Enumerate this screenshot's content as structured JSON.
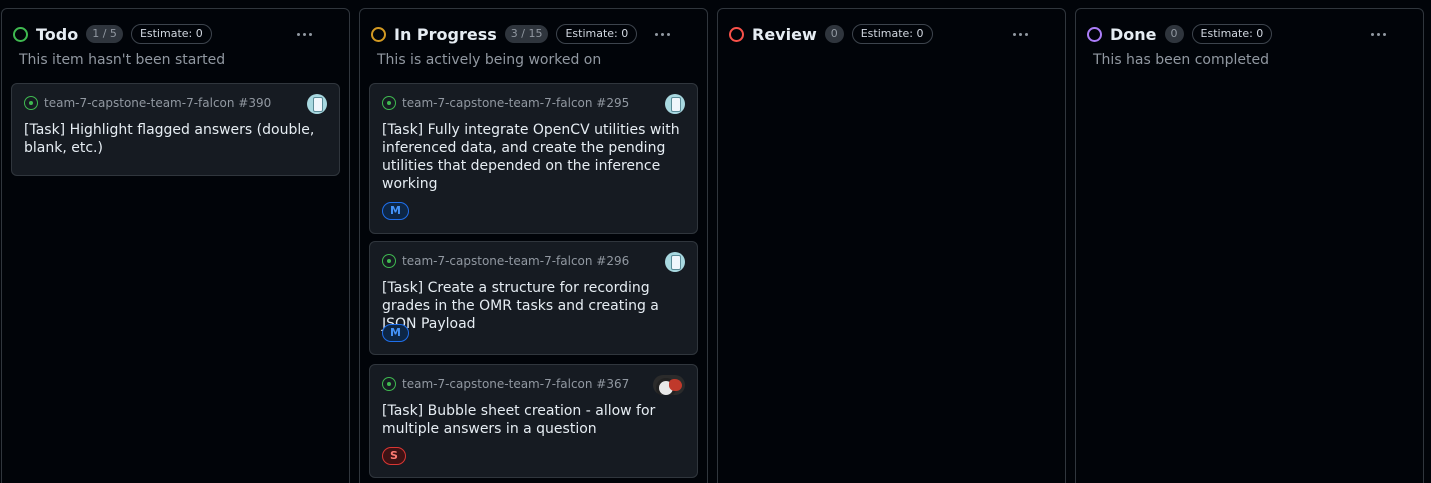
{
  "columns": [
    {
      "title": "Todo",
      "count": "1 / 5",
      "estimate": "Estimate: 0",
      "description": "This item hasn't been started",
      "status_color": "#3fb950",
      "cards": [
        {
          "repo": "team-7-capstone-team-7-falcon #390",
          "title": "[Task] Highlight flagged answers (double, blank, etc.)",
          "avatar": "robot-avatar",
          "size": ""
        }
      ]
    },
    {
      "title": "In Progress",
      "count": "3 / 15",
      "estimate": "Estimate: 0",
      "description": "This is actively being worked on",
      "status_color": "#d29922",
      "cards": [
        {
          "repo": "team-7-capstone-team-7-falcon #295",
          "title": "[Task] Fully integrate OpenCV utilities with inferenced data, and create the pending utilities that depended on the inference working",
          "avatar": "robot-avatar",
          "size": "M"
        },
        {
          "repo": "team-7-capstone-team-7-falcon #296",
          "title": "[Task] Create a structure for recording grades in the OMR tasks and creating a JSON Payload",
          "avatar": "robot-avatar",
          "size": "M"
        },
        {
          "repo": "team-7-capstone-team-7-falcon #367",
          "title": "[Task] Bubble sheet creation - allow for multiple answers in a question",
          "avatar": "photo-avatar",
          "size": "S"
        }
      ]
    },
    {
      "title": "Review",
      "count": "0",
      "estimate": "Estimate: 0",
      "description": "",
      "status_color": "#f85149",
      "cards": []
    },
    {
      "title": "Done",
      "count": "0",
      "estimate": "Estimate: 0",
      "description": "This has been completed",
      "status_color": "#ab7df8",
      "cards": []
    }
  ]
}
